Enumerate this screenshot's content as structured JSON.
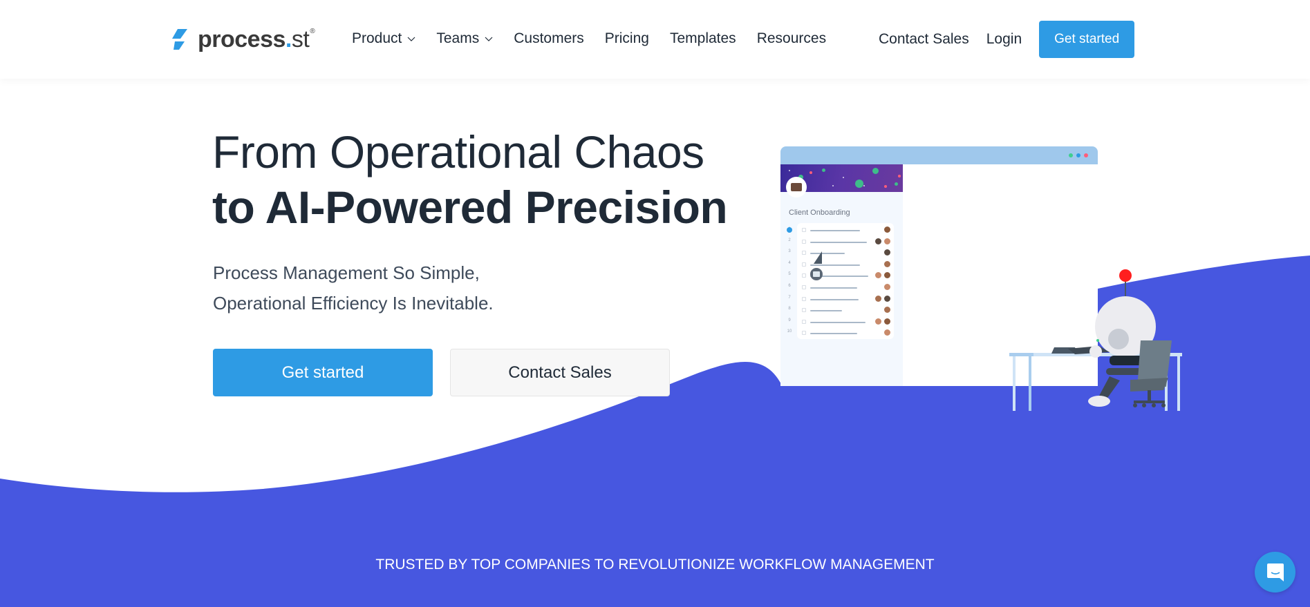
{
  "brand": {
    "name_main": "process",
    "name_dot": ".",
    "name_suffix": "st",
    "registered": "®",
    "accent": "#2e9be4",
    "wave_color": "#4757e0",
    "text_color": "#1f2a37"
  },
  "nav": {
    "links": [
      {
        "label": "Product",
        "has_dropdown": true
      },
      {
        "label": "Teams",
        "has_dropdown": true
      },
      {
        "label": "Customers",
        "has_dropdown": false
      },
      {
        "label": "Pricing",
        "has_dropdown": false
      },
      {
        "label": "Templates",
        "has_dropdown": false
      },
      {
        "label": "Resources",
        "has_dropdown": false
      }
    ],
    "contact_sales": "Contact Sales",
    "login": "Login",
    "get_started": "Get started"
  },
  "hero": {
    "title_line1": "From Operational Chaos",
    "title_line2": "to AI-Powered Precision",
    "subtitle_line1": "Process Management So Simple,",
    "subtitle_line2": "Operational Efficiency Is Inevitable.",
    "primary_cta": "Get started",
    "secondary_cta": "Contact Sales"
  },
  "illustration": {
    "checklist_title": "Client Onboarding",
    "row_numbers": [
      "1",
      "2",
      "3",
      "4",
      "5",
      "6",
      "7",
      "8",
      "9",
      "10"
    ],
    "window_dots": [
      "#3ecf8e",
      "#2e9be4",
      "#ff5d7a"
    ]
  },
  "trusted_banner": "TRUSTED BY TOP COMPANIES TO REVOLUTIONIZE WORKFLOW MANAGEMENT",
  "chat_widget": {
    "icon": "chat-bubble-icon"
  }
}
